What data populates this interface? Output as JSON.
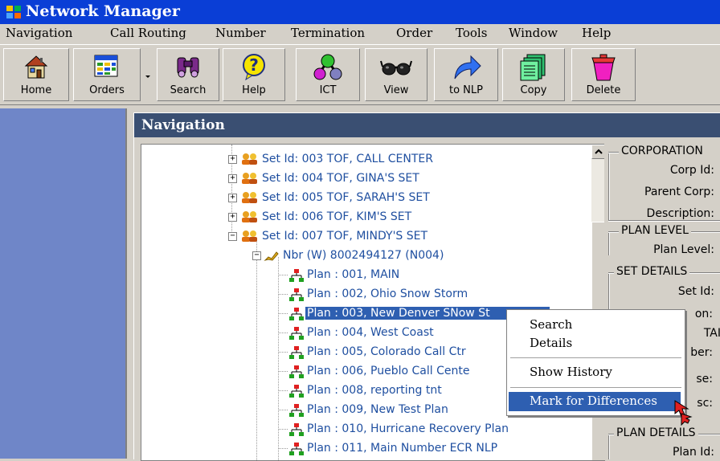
{
  "window": {
    "title": "Network Manager"
  },
  "menu": [
    "Navigation",
    "Call Routing",
    "Number",
    "Termination",
    "Order",
    "Tools",
    "Window",
    "Help"
  ],
  "toolbar": {
    "buttons": [
      {
        "label": "Home",
        "icon": "house-icon"
      },
      {
        "label": "Orders",
        "icon": "orders-table-icon"
      },
      {
        "label": "Search",
        "icon": "binoculars-icon"
      },
      {
        "label": "Help",
        "icon": "question-icon"
      },
      {
        "label": "ICT",
        "icon": "molecule-icon"
      },
      {
        "label": "View",
        "icon": "glasses-icon"
      },
      {
        "label": "to NLP",
        "icon": "curved-arrow-icon"
      },
      {
        "label": "Copy",
        "icon": "copy-pages-icon"
      },
      {
        "label": "Delete",
        "icon": "trash-icon"
      }
    ]
  },
  "nav": {
    "title": "Navigation",
    "sets": [
      {
        "label": "Set Id:  003 TOF, CALL CENTER"
      },
      {
        "label": "Set Id:  004 TOF, GINA'S SET"
      },
      {
        "label": "Set Id:  005 TOF, SARAH'S SET"
      },
      {
        "label": "Set Id:  006 TOF, KIM'S SET"
      },
      {
        "label": "Set Id:  007 TOF, MINDY'S SET"
      }
    ],
    "number_node": "Nbr (W) 8002494127 (N004)",
    "plans": [
      "Plan : 001, MAIN",
      "Plan : 002, Ohio Snow Storm",
      "Plan : 003, New Denver SNow St",
      "Plan : 004, West Coast",
      "Plan : 005, Colorado Call Ctr",
      "Plan : 006, Pueblo Call Cente",
      "Plan : 008, reporting tnt",
      "Plan : 009, New Test Plan",
      "Plan : 010, Hurricane Recovery Plan",
      "Plan : 011, Main Number ECR NLP"
    ],
    "selected_plan_index": 2
  },
  "details": {
    "corporation": {
      "title": "CORPORATION",
      "fields": [
        "Corp Id:",
        "Parent Corp:",
        "Description:"
      ]
    },
    "plan_level": {
      "title": "PLAN LEVEL",
      "fields": [
        "Plan Level:"
      ]
    },
    "set_details": {
      "title": "SET DETAILS",
      "fields": [
        "Set Id:",
        "on:",
        "TAI",
        "ber:",
        "se:",
        "sc:"
      ]
    },
    "plan_details": {
      "title": "PLAN DETAILS",
      "fields": [
        "Plan Id:"
      ]
    }
  },
  "context_menu": {
    "items": [
      "Search",
      "Details",
      "Show History",
      "Mark for Differences"
    ],
    "highlighted": "Mark for Differences"
  },
  "colors": {
    "titlebar": "#0a3ed6",
    "nav_title": "#3a4f72",
    "sidebar": "#6f86c8",
    "selection": "#2e5fb1",
    "tree_text": "#1f4fa0"
  }
}
